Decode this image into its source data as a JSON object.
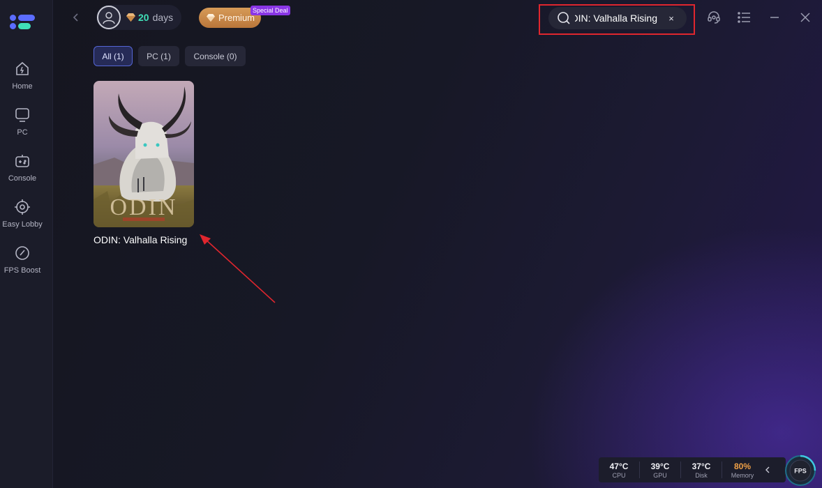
{
  "sidebar": {
    "items": [
      {
        "label": "Home",
        "icon": "home-icon"
      },
      {
        "label": "PC",
        "icon": "monitor-icon"
      },
      {
        "label": "Console",
        "icon": "gamepad-icon"
      },
      {
        "label": "Easy Lobby",
        "icon": "crosshair-icon"
      },
      {
        "label": "FPS Boost",
        "icon": "speedometer-icon"
      }
    ]
  },
  "header": {
    "membership_days": "20",
    "days_label": "days",
    "premium_label": "Premium",
    "deal_badge": "Special Deal",
    "search_value": "ODIN: Valhalla Rising",
    "clear_label": "×"
  },
  "filters": {
    "tabs": [
      {
        "label": "All (1)",
        "active": true
      },
      {
        "label": "PC (1)",
        "active": false
      },
      {
        "label": "Console (0)",
        "active": false
      }
    ]
  },
  "results": [
    {
      "title": "ODIN: Valhalla Rising",
      "cover_text": "ODIN"
    }
  ],
  "status": {
    "cpu": {
      "value": "47°C",
      "label": "CPU"
    },
    "gpu": {
      "value": "39°C",
      "label": "GPU"
    },
    "disk": {
      "value": "37°C",
      "label": "Disk"
    },
    "memory": {
      "value": "80%",
      "label": "Memory"
    },
    "fps_label": "FPS"
  },
  "colors": {
    "accent_green": "#3fe0b8",
    "premium_gold": "#c98a48",
    "deal_purple": "#8a36e6",
    "highlight_red": "#e0262e",
    "warn_orange": "#f0a046"
  }
}
